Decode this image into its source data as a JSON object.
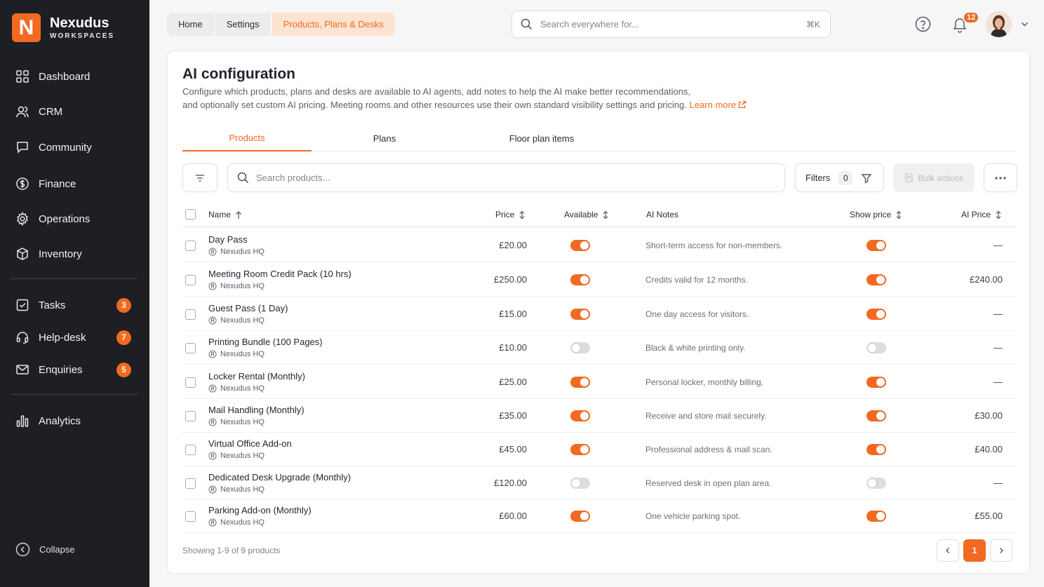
{
  "brand": {
    "letter": "N",
    "name": "Nexudus",
    "sub": "WORKSPACES",
    "accent": "#f26a21"
  },
  "sidebar": {
    "items": [
      {
        "label": "Dashboard",
        "icon": "dashboard-icon"
      },
      {
        "label": "CRM",
        "icon": "users-icon"
      },
      {
        "label": "Community",
        "icon": "chat-icon"
      },
      {
        "label": "Finance",
        "icon": "dollar-icon"
      },
      {
        "label": "Operations",
        "icon": "gear-icon"
      },
      {
        "label": "Inventory",
        "icon": "box-icon"
      },
      {
        "label": "Tasks",
        "icon": "checkbox-icon",
        "badge": "3"
      },
      {
        "label": "Help-desk",
        "icon": "headset-icon",
        "badge": "7"
      },
      {
        "label": "Enquiries",
        "icon": "mail-icon",
        "badge": "5"
      },
      {
        "label": "Analytics",
        "icon": "bar-chart-icon"
      }
    ],
    "collapse_label": "Collapse"
  },
  "header": {
    "breadcrumb": [
      "Home",
      "Settings",
      "Products, Plans & Desks"
    ],
    "search_placeholder": "Search everywhere for...",
    "search_shortcut": "⌘K",
    "notification_count": "12"
  },
  "page": {
    "title": "AI configuration",
    "description_line1": "Configure which products, plans and desks are available to AI agents, add notes to help the AI make better recommendations,",
    "description_line2": "and optionally set custom AI pricing. Meeting rooms and other resources use their own standard visibility settings and pricing.",
    "learn_more": "Learn more",
    "tabs": [
      "Products",
      "Plans",
      "Floor plan items"
    ],
    "active_tab": "Products"
  },
  "toolbar": {
    "search_placeholder": "Search products...",
    "filters_label": "Filters",
    "filters_count": "0",
    "bulk_label": "Bulk actions"
  },
  "table": {
    "columns": {
      "name": "Name",
      "price": "Price",
      "available": "Available",
      "notes": "AI Notes",
      "show_price": "Show price",
      "ai_price": "AI Price"
    },
    "rows": [
      {
        "name": "Day Pass",
        "location": "Nexudus HQ",
        "price": "£20.00",
        "available": true,
        "notes": "Short-term access for non-members.",
        "show_price": true,
        "ai_price": "—"
      },
      {
        "name": "Meeting Room Credit Pack (10 hrs)",
        "location": "Nexudus HQ",
        "price": "£250.00",
        "available": true,
        "notes": "Credits valid for 12 months.",
        "show_price": true,
        "ai_price": "£240.00"
      },
      {
        "name": "Guest Pass (1 Day)",
        "location": "Nexudus HQ",
        "price": "£15.00",
        "available": true,
        "notes": "One day access for visitors.",
        "show_price": true,
        "ai_price": "—"
      },
      {
        "name": "Printing Bundle (100 Pages)",
        "location": "Nexudus HQ",
        "price": "£10.00",
        "available": false,
        "notes": "Black & white printing only.",
        "show_price": false,
        "ai_price": "—"
      },
      {
        "name": "Locker Rental (Monthly)",
        "location": "Nexudus HQ",
        "price": "£25.00",
        "available": true,
        "notes": "Personal locker, monthly billing.",
        "show_price": true,
        "ai_price": "—"
      },
      {
        "name": "Mail Handling (Monthly)",
        "location": "Nexudus HQ",
        "price": "£35.00",
        "available": true,
        "notes": "Receive and store mail securely.",
        "show_price": true,
        "ai_price": "£30.00"
      },
      {
        "name": "Virtual Office Add-on",
        "location": "Nexudus HQ",
        "price": "£45.00",
        "available": true,
        "notes": "Professional address & mail scan.",
        "show_price": true,
        "ai_price": "£40.00"
      },
      {
        "name": "Dedicated Desk Upgrade (Monthly)",
        "location": "Nexudus HQ",
        "price": "£120.00",
        "available": false,
        "notes": "Reserved desk in open plan area.",
        "show_price": false,
        "ai_price": "—"
      },
      {
        "name": "Parking Add-on (Monthly)",
        "location": "Nexudus HQ",
        "price": "£60.00",
        "available": true,
        "notes": "One vehicle parking spot.",
        "show_price": true,
        "ai_price": "£55.00"
      }
    ]
  },
  "footer": {
    "showing": "Showing 1-9 of 9 products",
    "current_page": "1"
  }
}
